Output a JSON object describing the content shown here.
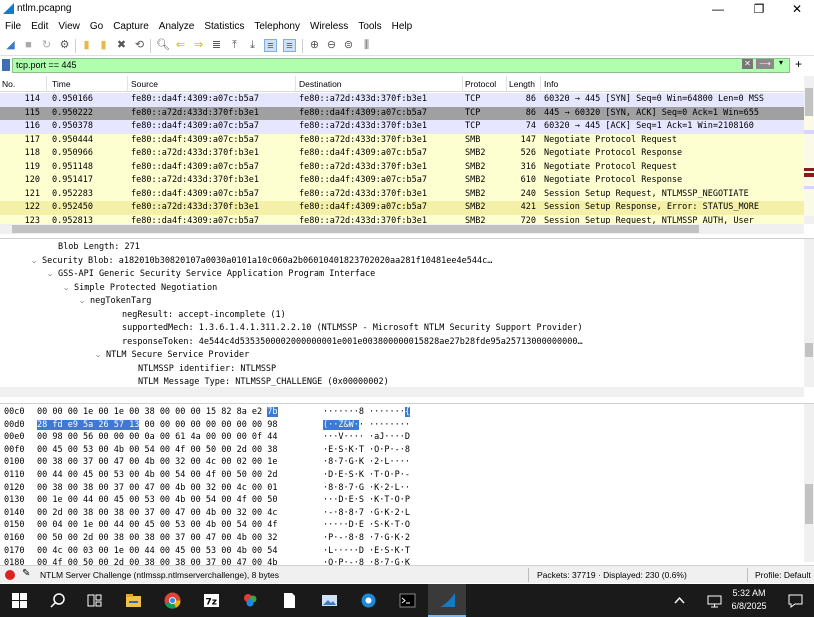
{
  "window": {
    "title": "ntlm.pcapng",
    "minimize": "—",
    "maximize": "❐",
    "close": "✕"
  },
  "menu": [
    "File",
    "Edit",
    "View",
    "Go",
    "Capture",
    "Analyze",
    "Statistics",
    "Telephony",
    "Wireless",
    "Tools",
    "Help"
  ],
  "toolbar_icons": [
    "start-capture-icon",
    "stop-capture-icon",
    "restart-capture-icon",
    "capture-options-icon",
    "open-file-icon",
    "save-file-icon",
    "close-file-icon",
    "reload-file-icon",
    "find-packet-icon",
    "go-back-icon",
    "go-forward-icon",
    "go-to-packet-icon",
    "go-first-icon",
    "go-last-icon",
    "autoscroll-icon",
    "colorize-icon",
    "zoom-in-icon",
    "zoom-out-icon",
    "zoom-normal-icon",
    "resize-columns-icon"
  ],
  "filter": {
    "value": "tcp.port == 445",
    "clear": "✕",
    "apply": "⟶",
    "dropdown": "▾",
    "add": "+"
  },
  "packet_list": {
    "columns": [
      "No.",
      "Time",
      "Source",
      "Destination",
      "Protocol",
      "Length",
      "Info"
    ],
    "rows": [
      {
        "no": "114",
        "time": "0.950166",
        "src": "fe80::da4f:4309:a07c:b5a7",
        "dst": "fe80::a72d:433d:370f:b3e1",
        "proto": "TCP",
        "len": "86",
        "info": "60320 → 445 [SYN] Seq=0 Win=64800 Len=0 MSS",
        "bg": "#e7e6ff"
      },
      {
        "no": "115",
        "time": "0.950222",
        "src": "fe80::a72d:433d:370f:b3e1",
        "dst": "fe80::da4f:4309:a07c:b5a7",
        "proto": "TCP",
        "len": "86",
        "info": "445 → 60320 [SYN, ACK] Seq=0 Ack=1 Win=655",
        "bg": "#a0a0a0"
      },
      {
        "no": "116",
        "time": "0.950378",
        "src": "fe80::da4f:4309:a07c:b5a7",
        "dst": "fe80::a72d:433d:370f:b3e1",
        "proto": "TCP",
        "len": "74",
        "info": "60320 → 445 [ACK] Seq=1 Ack=1 Win=2108160",
        "bg": "#e7e6ff"
      },
      {
        "no": "117",
        "time": "0.950444",
        "src": "fe80::da4f:4309:a07c:b5a7",
        "dst": "fe80::a72d:433d:370f:b3e1",
        "proto": "SMB",
        "len": "147",
        "info": "Negotiate Protocol Request",
        "bg": "#feffd0"
      },
      {
        "no": "118",
        "time": "0.950966",
        "src": "fe80::a72d:433d:370f:b3e1",
        "dst": "fe80::da4f:4309:a07c:b5a7",
        "proto": "SMB2",
        "len": "526",
        "info": "Negotiate Protocol Response",
        "bg": "#feffd0"
      },
      {
        "no": "119",
        "time": "0.951148",
        "src": "fe80::da4f:4309:a07c:b5a7",
        "dst": "fe80::a72d:433d:370f:b3e1",
        "proto": "SMB2",
        "len": "316",
        "info": "Negotiate Protocol Request",
        "bg": "#feffd0"
      },
      {
        "no": "120",
        "time": "0.951417",
        "src": "fe80::a72d:433d:370f:b3e1",
        "dst": "fe80::da4f:4309:a07c:b5a7",
        "proto": "SMB2",
        "len": "610",
        "info": "Negotiate Protocol Response",
        "bg": "#feffd0"
      },
      {
        "no": "121",
        "time": "0.952283",
        "src": "fe80::da4f:4309:a07c:b5a7",
        "dst": "fe80::a72d:433d:370f:b3e1",
        "proto": "SMB2",
        "len": "240",
        "info": "Session Setup Request, NTLMSSP_NEGOTIATE",
        "bg": "#feffd0"
      },
      {
        "no": "122",
        "time": "0.952450",
        "src": "fe80::a72d:433d:370f:b3e1",
        "dst": "fe80::da4f:4309:a07c:b5a7",
        "proto": "SMB2",
        "len": "421",
        "info": "Session Setup Response, Error: STATUS_MORE",
        "bg": "#f5f0a8"
      },
      {
        "no": "123",
        "time": "0.952813",
        "src": "fe80::da4f:4309:a07c:b5a7",
        "dst": "fe80::a72d:433d:370f:b3e1",
        "proto": "SMB2",
        "len": "720",
        "info": "Session Setup Request, NTLMSSP_AUTH, User",
        "bg": "#feffd0"
      }
    ]
  },
  "details": [
    {
      "indent": 3,
      "tri": "",
      "text": "Blob Length: 271"
    },
    {
      "indent": 2,
      "tri": "v",
      "text": "Security Blob: a182010b30820107a0030a0101a10c060a2b06010401823702020aa281f10481ee4e544c…"
    },
    {
      "indent": 3,
      "tri": "v",
      "text": "GSS-API Generic Security Service Application Program Interface"
    },
    {
      "indent": 4,
      "tri": "v",
      "text": "Simple Protected Negotiation"
    },
    {
      "indent": 5,
      "tri": "v",
      "text": "negTokenTarg"
    },
    {
      "indent": 7,
      "tri": "",
      "text": "negResult: accept-incomplete (1)"
    },
    {
      "indent": 7,
      "tri": "",
      "text": "supportedMech: 1.3.6.1.4.1.311.2.2.10 (NTLMSSP - Microsoft NTLM Security Support Provider)"
    },
    {
      "indent": 7,
      "tri": "",
      "text": "responseToken: 4e544c4d5353500002000000001e001e003800000015828ae27b28fde95a25713000000000…"
    },
    {
      "indent": 6,
      "tri": "v",
      "text": "NTLM Secure Service Provider"
    },
    {
      "indent": 8,
      "tri": "",
      "text": "NTLMSSP identifier: NTLMSSP"
    },
    {
      "indent": 8,
      "tri": "",
      "text": "NTLM Message Type: NTLMSSP_CHALLENGE (0x00000002)"
    }
  ],
  "bytes": [
    {
      "off": "00c0",
      "hex": "00 00 00 1e 00 1e 00 38   00 00 00 15 82 8a e2 7b",
      "ascii": "·······8 ·······{"
    },
    {
      "off": "00d0",
      "hex": "28 fd e9 5a 26 57 13 00   00 00 00 00 00 00 00 98",
      "ascii": "(··Z&W·· ········"
    },
    {
      "off": "00e0",
      "hex": "00 98 00 56 00 00 00 0a   00 61 4a 00 00 00 0f 44",
      "ascii": "···V···· ·aJ····D"
    },
    {
      "off": "00f0",
      "hex": "00 45 00 53 00 4b 00 54   00 4f 00 50 00 2d 00 38",
      "ascii": "·E·S·K·T ·O·P·-·8"
    },
    {
      "off": "0100",
      "hex": "00 38 00 37 00 47 00 4b   00 32 00 4c 00 02 00 1e",
      "ascii": "·8·7·G·K ·2·L····"
    },
    {
      "off": "0110",
      "hex": "00 44 00 45 00 53 00 4b   00 54 00 4f 00 50 00 2d",
      "ascii": "·D·E·S·K ·T·O·P·-"
    },
    {
      "off": "0120",
      "hex": "00 38 00 38 00 37 00 47   00 4b 00 32 00 4c 00 01",
      "ascii": "·8·8·7·G ·K·2·L··"
    },
    {
      "off": "0130",
      "hex": "00 1e 00 44 00 45 00 53   00 4b 00 54 00 4f 00 50",
      "ascii": "···D·E·S ·K·T·O·P"
    },
    {
      "off": "0140",
      "hex": "00 2d 00 38 00 38 00 37   00 47 00 4b 00 32 00 4c",
      "ascii": "·-·8·8·7 ·G·K·2·L"
    },
    {
      "off": "0150",
      "hex": "00 04 00 1e 00 44 00 45   00 53 00 4b 00 54 00 4f",
      "ascii": "·····D·E ·S·K·T·O"
    },
    {
      "off": "0160",
      "hex": "00 50 00 2d 00 38 00 38   00 37 00 47 00 4b 00 32",
      "ascii": "·P·-·8·8 ·7·G·K·2"
    },
    {
      "off": "0170",
      "hex": "00 4c 00 03 00 1e 00 44   00 45 00 53 00 4b 00 54",
      "ascii": "·L·····D ·E·S·K·T"
    },
    {
      "off": "0180",
      "hex": "00 4f 00 50 00 2d 00 38   00 38 00 37 00 47 00 4b",
      "ascii": "·O·P·-·8 ·8·7·G·K"
    }
  ],
  "bytes_highlight": {
    "row0_hex": "7b",
    "row0_ascii": "{",
    "row1_hex": "28 fd e9 5a 26 57 13",
    "row1_ascii": "(··Z&W·"
  },
  "status": {
    "field": "NTLM Server Challenge (ntlmssp.ntlmserverchallenge), 8 bytes",
    "packets": "Packets: 37719 · Displayed: 230 (0.6%)",
    "profile": "Profile: Default"
  },
  "taskbar": {
    "time": "5:32 AM",
    "date": "6/8/2025",
    "items": [
      "windows-start-icon",
      "search-icon",
      "task-view-icon",
      "file-explorer-icon",
      "chrome-icon",
      "7zip-icon",
      "paint-icon",
      "notepad-icon",
      "screenshot-tool-icon",
      "settings-icon",
      "terminal-icon",
      "wireshark-icon"
    ]
  },
  "colors": {
    "filter_ok": "#afffaf",
    "selected_bytes": "#3b7bd6",
    "tcp_row": "#e7e6ff",
    "smb_row": "#feffd0",
    "taskbar": "#1a1a1a"
  }
}
